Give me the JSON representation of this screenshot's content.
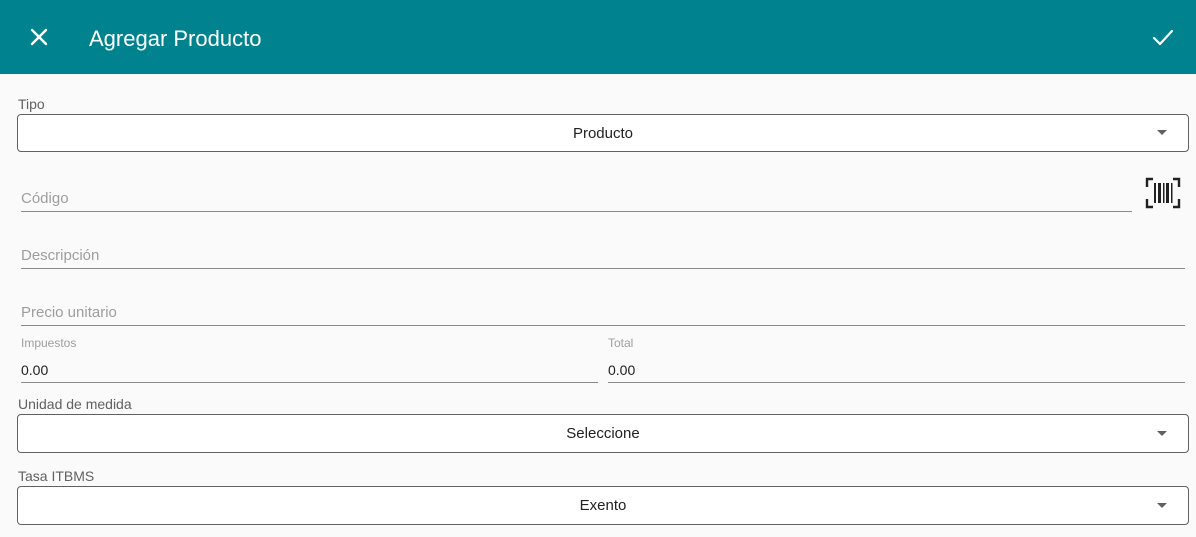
{
  "header": {
    "title": "Agregar Producto"
  },
  "form": {
    "tipo": {
      "label": "Tipo",
      "value": "Producto"
    },
    "codigo": {
      "placeholder": "Código"
    },
    "descripcion": {
      "placeholder": "Descripción"
    },
    "precio_unitario": {
      "placeholder": "Precio unitario"
    },
    "impuestos": {
      "label": "Impuestos",
      "value": "0.00"
    },
    "total": {
      "label": "Total",
      "value": "0.00"
    },
    "unidad_medida": {
      "label": "Unidad de medida",
      "value": "Seleccione"
    },
    "tasa_itbms": {
      "label": "Tasa ITBMS",
      "value": "Exento"
    }
  },
  "icons": {
    "close": "close-icon",
    "confirm": "check-icon",
    "barcode": "barcode-scan-icon",
    "dropdown": "dropdown-arrow-icon"
  },
  "colors": {
    "appbar": "#00838f",
    "background": "#fafafa"
  }
}
